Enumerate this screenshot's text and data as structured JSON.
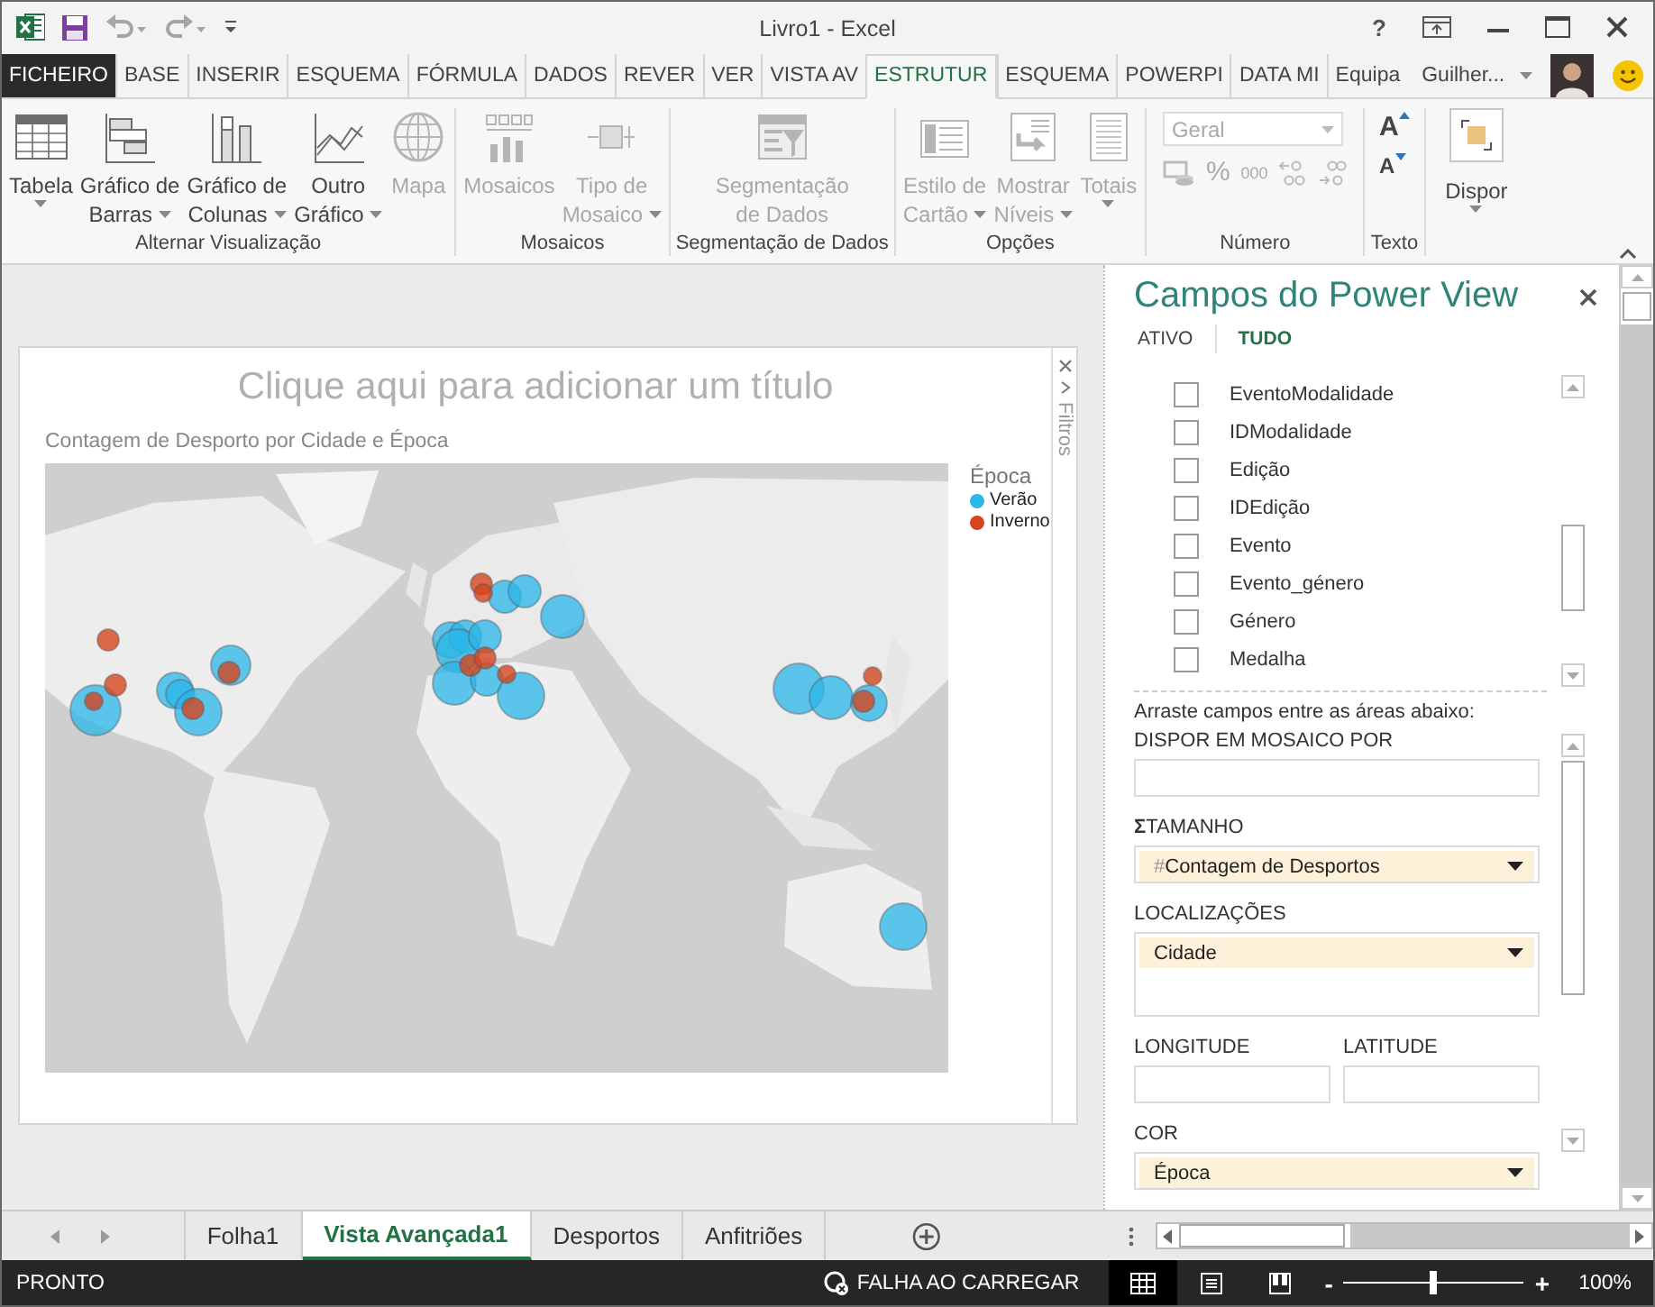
{
  "window": {
    "title": "Livro1 - Excel",
    "help": "?"
  },
  "ribbon_tabs": [
    {
      "label": "FICHEIRO",
      "kind": "file",
      "selected": false
    },
    {
      "label": "BASE",
      "kind": "tab",
      "selected": false
    },
    {
      "label": "INSERIR",
      "kind": "tab",
      "selected": false
    },
    {
      "label": "ESQUEMA",
      "kind": "tab",
      "selected": false
    },
    {
      "label": "FÓRMULA",
      "kind": "tab",
      "selected": false
    },
    {
      "label": "DADOS",
      "kind": "tab",
      "selected": false
    },
    {
      "label": "REVER",
      "kind": "tab",
      "selected": false
    },
    {
      "label": "VER",
      "kind": "tab",
      "selected": false
    },
    {
      "label": "VISTA AV",
      "kind": "tab",
      "selected": false
    },
    {
      "label": "ESTRUTUR",
      "kind": "tab",
      "selected": true
    },
    {
      "label": "ESQUEMA",
      "kind": "tab",
      "selected": false
    },
    {
      "label": "POWERPI",
      "kind": "tab",
      "selected": false
    },
    {
      "label": "DATA MI",
      "kind": "tab",
      "selected": false
    },
    {
      "label": "Equipa",
      "kind": "tab",
      "selected": false
    }
  ],
  "user": {
    "name": "Guilher..."
  },
  "ribbon": {
    "groups": [
      {
        "label": "Alternar Visualização",
        "buttons": [
          {
            "lines": [
              "Tabela"
            ],
            "dropdown": true,
            "disabled": false
          },
          {
            "lines": [
              "Gráfico de",
              "Barras"
            ],
            "dropdown": true,
            "disabled": false
          },
          {
            "lines": [
              "Gráfico de",
              "Colunas"
            ],
            "dropdown": true,
            "disabled": false
          },
          {
            "lines": [
              "Outro",
              "Gráfico"
            ],
            "dropdown": true,
            "disabled": false
          },
          {
            "lines": [
              "Mapa"
            ],
            "dropdown": false,
            "disabled": true
          }
        ]
      },
      {
        "label": "Mosaicos",
        "buttons": [
          {
            "lines": [
              "Mosaicos"
            ],
            "dropdown": false,
            "disabled": true
          },
          {
            "lines": [
              "Tipo de",
              "Mosaico"
            ],
            "dropdown": true,
            "disabled": true
          }
        ]
      },
      {
        "label": "Segmentação de Dados",
        "buttons": [
          {
            "lines": [
              "Segmentação",
              "de Dados"
            ],
            "dropdown": false,
            "disabled": true
          }
        ]
      },
      {
        "label": "Opções",
        "buttons": [
          {
            "lines": [
              "Estilo de",
              "Cartão"
            ],
            "dropdown": true,
            "disabled": true
          },
          {
            "lines": [
              "Mostrar",
              "Níveis"
            ],
            "dropdown": true,
            "disabled": true
          },
          {
            "lines": [
              "Totais"
            ],
            "dropdown": true,
            "disabled": true
          }
        ]
      }
    ],
    "number_group": {
      "label": "Número",
      "format": "Geral",
      "disabled": true,
      "symbols": [
        "%",
        "000"
      ]
    },
    "text_group": {
      "label": "Texto",
      "buttons": [
        "A",
        "A"
      ]
    },
    "arrange_button": {
      "label": "Dispor",
      "dropdown": true
    }
  },
  "canvas": {
    "title_placeholder": "Clique aqui para adicionar um título",
    "filters": {
      "label": "Filtros"
    },
    "chart": {
      "title": "Contagem de Desporto por Cidade e Época",
      "legend": {
        "title": "Época",
        "items": [
          {
            "label": "Verão",
            "color": "#29b6e8"
          },
          {
            "label": "Inverno",
            "color": "#d4461f"
          }
        ]
      }
    }
  },
  "fields_panel": {
    "title": "Campos do Power View",
    "tabs": [
      {
        "label": "ATIVO",
        "selected": false
      },
      {
        "label": "TUDO",
        "selected": true
      }
    ],
    "fields": [
      {
        "label": "EventoModalidade",
        "checked": false
      },
      {
        "label": "IDModalidade",
        "checked": false
      },
      {
        "label": "Edição",
        "checked": false
      },
      {
        "label": "IDEdição",
        "checked": false
      },
      {
        "label": "Evento",
        "checked": false
      },
      {
        "label": "Evento_género",
        "checked": false
      },
      {
        "label": "Género",
        "checked": false
      },
      {
        "label": "Medalha",
        "checked": false
      }
    ],
    "hint": "Arraste campos entre as áreas abaixo:",
    "areas": [
      {
        "label": "DISPOR EM MOSAICO POR",
        "kind": "single"
      },
      {
        "label": "TAMANHO",
        "symbol": "Σ",
        "kind": "single",
        "entries": [
          {
            "prefix": "#",
            "label": "Contagem de Desportos"
          }
        ]
      },
      {
        "label": "LOCALIZAÇÕES",
        "kind": "multi",
        "entries": [
          {
            "label": "Cidade"
          }
        ]
      },
      {
        "label": "LONGITUDE",
        "kind": "half"
      },
      {
        "label": "LATITUDE",
        "kind": "half"
      },
      {
        "label": "COR",
        "kind": "single",
        "entries": [
          {
            "label": "Época"
          }
        ]
      }
    ]
  },
  "sheet_tabs": [
    {
      "label": "Folha1",
      "selected": false
    },
    {
      "label": "Vista Avançada1",
      "selected": true
    },
    {
      "label": "Desportos",
      "selected": false
    },
    {
      "label": "Anfitriões",
      "selected": false
    }
  ],
  "status_bar": {
    "status": "PRONTO",
    "warning": "FALHA AO CARREGAR",
    "views": [
      {
        "selected": true
      },
      {
        "selected": false
      },
      {
        "selected": false
      }
    ],
    "zoom": {
      "minus": "-",
      "plus": "+",
      "level": 0.5,
      "reading": "100%"
    }
  }
}
